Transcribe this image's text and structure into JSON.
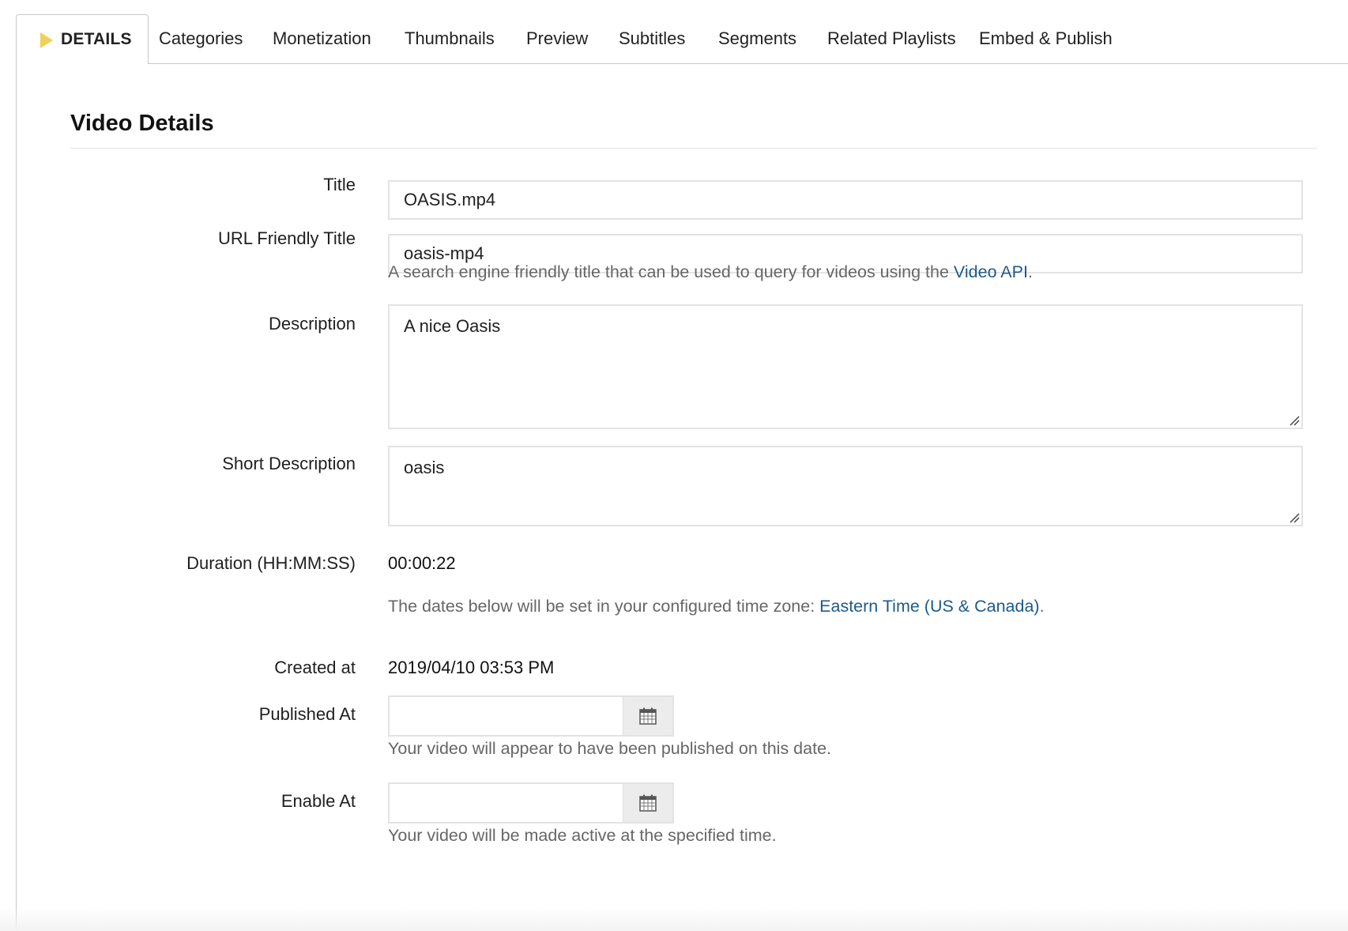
{
  "tabs": [
    {
      "label": "DETAILS",
      "active": true
    },
    {
      "label": "Categories"
    },
    {
      "label": "Monetization"
    },
    {
      "label": "Thumbnails"
    },
    {
      "label": "Preview"
    },
    {
      "label": "Subtitles"
    },
    {
      "label": "Segments"
    },
    {
      "label": "Related Playlists"
    },
    {
      "label": "Embed & Publish"
    }
  ],
  "section_title": "Video Details",
  "form": {
    "title": {
      "label": "Title",
      "value": "OASIS.mp4"
    },
    "url_title": {
      "label": "URL Friendly Title",
      "value": "oasis-mp4",
      "help_prefix": "A search engine friendly title that can be used to query for videos using the ",
      "help_link": "Video API",
      "help_suffix": "."
    },
    "description": {
      "label": "Description",
      "value": "A nice Oasis"
    },
    "short_description": {
      "label": "Short Description",
      "value": "oasis"
    },
    "duration": {
      "label": "Duration (HH:MM:SS)",
      "value": "00:00:22"
    },
    "timezone_note": {
      "prefix": "The dates below will be set in your configured time zone: ",
      "link": "Eastern Time (US & Canada)",
      "suffix": "."
    },
    "created_at": {
      "label": "Created at",
      "value": "2019/04/10 03:53 PM"
    },
    "published_at": {
      "label": "Published At",
      "value": "",
      "help": "Your video will appear to have been published on this date."
    },
    "enable_at": {
      "label": "Enable At",
      "value": "",
      "help": "Your video will be made active at the specified time."
    }
  },
  "colors": {
    "accent": "#eed157",
    "link": "#1d5a8a"
  }
}
